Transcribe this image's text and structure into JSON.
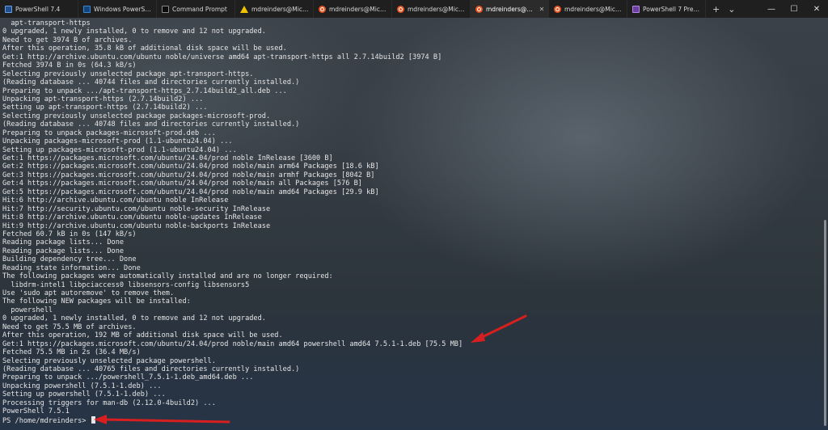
{
  "tabs": [
    {
      "label": "PowerShell 7.4",
      "icon": "powershell-icon",
      "active": false
    },
    {
      "label": "Windows PowerShell",
      "icon": "windows-powershell-icon",
      "active": false
    },
    {
      "label": "Command Prompt",
      "icon": "command-prompt-icon",
      "active": false
    },
    {
      "label": "mdreinders@Michae",
      "icon": "warning-icon",
      "active": false
    },
    {
      "label": "mdreinders@Michae",
      "icon": "ubuntu-icon",
      "active": false
    },
    {
      "label": "mdreinders@Michae",
      "icon": "ubuntu-icon",
      "active": false
    },
    {
      "label": "mdreinders@Michae",
      "icon": "ubuntu-icon",
      "active": true
    },
    {
      "label": "mdreinders@Michae",
      "icon": "ubuntu-icon",
      "active": false
    },
    {
      "label": "PowerShell 7 Preview",
      "icon": "powershell-preview-icon",
      "active": false
    }
  ],
  "tab_tools": {
    "new_tab": "+",
    "dropdown": "⌄"
  },
  "window_controls": {
    "minimize": "—",
    "maximize": "☐",
    "close": "✕"
  },
  "terminal": {
    "lines": [
      "  apt-transport-https",
      "0 upgraded, 1 newly installed, 0 to remove and 12 not upgraded.",
      "Need to get 3974 B of archives.",
      "After this operation, 35.8 kB of additional disk space will be used.",
      "Get:1 http://archive.ubuntu.com/ubuntu noble/universe amd64 apt-transport-https all 2.7.14build2 [3974 B]",
      "Fetched 3974 B in 0s (64.3 kB/s)",
      "Selecting previously unselected package apt-transport-https.",
      "(Reading database ... 40744 files and directories currently installed.)",
      "Preparing to unpack .../apt-transport-https_2.7.14build2_all.deb ...",
      "Unpacking apt-transport-https (2.7.14build2) ...",
      "Setting up apt-transport-https (2.7.14build2) ...",
      "Selecting previously unselected package packages-microsoft-prod.",
      "(Reading database ... 40748 files and directories currently installed.)",
      "Preparing to unpack packages-microsoft-prod.deb ...",
      "Unpacking packages-microsoft-prod (1.1-ubuntu24.04) ...",
      "Setting up packages-microsoft-prod (1.1-ubuntu24.04) ...",
      "Get:1 https://packages.microsoft.com/ubuntu/24.04/prod noble InRelease [3600 B]",
      "Get:2 https://packages.microsoft.com/ubuntu/24.04/prod noble/main arm64 Packages [18.6 kB]",
      "Get:3 https://packages.microsoft.com/ubuntu/24.04/prod noble/main armhf Packages [8042 B]",
      "Get:4 https://packages.microsoft.com/ubuntu/24.04/prod noble/main all Packages [576 B]",
      "Get:5 https://packages.microsoft.com/ubuntu/24.04/prod noble/main amd64 Packages [29.9 kB]",
      "Hit:6 http://archive.ubuntu.com/ubuntu noble InRelease",
      "Hit:7 http://security.ubuntu.com/ubuntu noble-security InRelease",
      "Hit:8 http://archive.ubuntu.com/ubuntu noble-updates InRelease",
      "Hit:9 http://archive.ubuntu.com/ubuntu noble-backports InRelease",
      "Fetched 60.7 kB in 0s (147 kB/s)",
      "Reading package lists... Done",
      "Reading package lists... Done",
      "Building dependency tree... Done",
      "Reading state information... Done",
      "The following packages were automatically installed and are no longer required:",
      "  libdrm-intel1 libpciaccess0 libsensors-config libsensors5",
      "Use 'sudo apt autoremove' to remove them.",
      "The following NEW packages will be installed:",
      "  powershell",
      "0 upgraded, 1 newly installed, 0 to remove and 12 not upgraded.",
      "Need to get 75.5 MB of archives.",
      "After this operation, 192 MB of additional disk space will be used.",
      "Get:1 https://packages.microsoft.com/ubuntu/24.04/prod noble/main amd64 powershell amd64 7.5.1-1.deb [75.5 MB]",
      "Fetched 75.5 MB in 2s (36.4 MB/s)",
      "Selecting previously unselected package powershell.",
      "(Reading database ... 40765 files and directories currently installed.)",
      "Preparing to unpack .../powershell_7.5.1-1.deb_amd64.deb ...",
      "Unpacking powershell (7.5.1-1.deb) ...",
      "Setting up powershell (7.5.1-1.deb) ...",
      "Processing triggers for man-db (2.12.0-4build2) ...",
      "PowerShell 7.5.1"
    ],
    "prompt": "PS /home/mdreinders> "
  },
  "colors": {
    "annotation_arrow": "#d81f1f",
    "terminal_text": "#e6e6e6",
    "tabbar_background": "#1f1f1f"
  }
}
